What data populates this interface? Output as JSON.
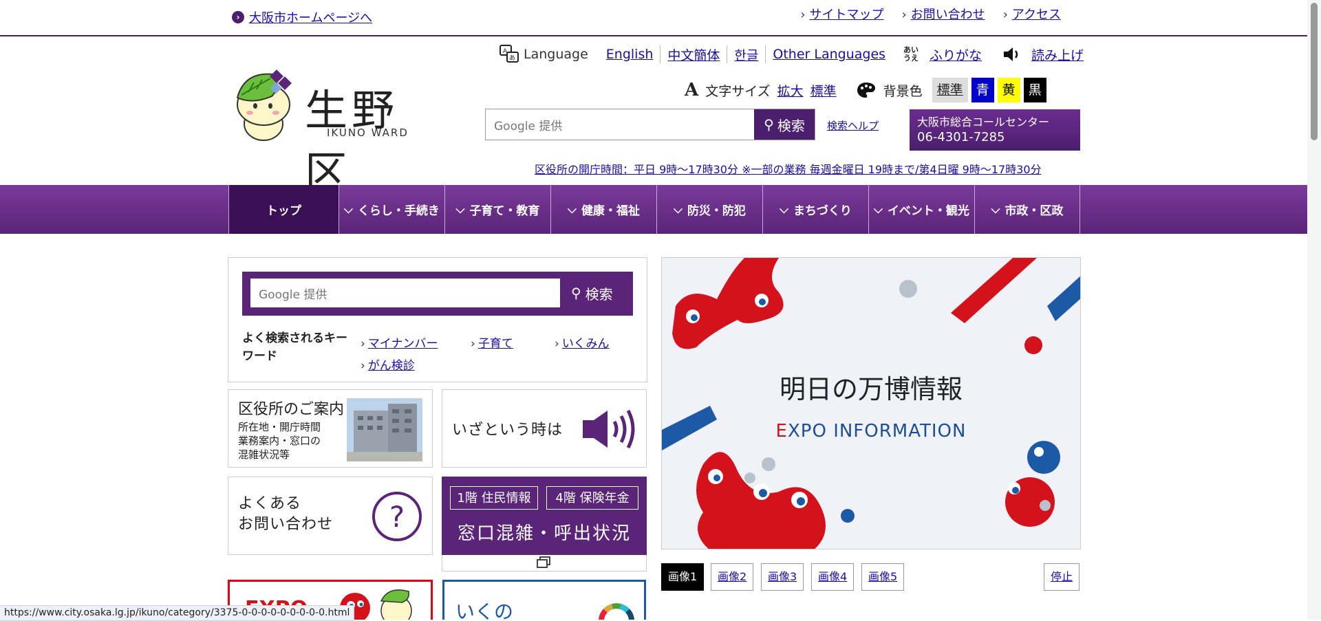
{
  "top": {
    "home_link": "大阪市ホームページへ",
    "links": [
      "サイトマップ",
      "お問い合わせ",
      "アクセス"
    ]
  },
  "header": {
    "logo_text": "生野区",
    "logo_sub": "IKUNO WARD",
    "language_label": "Language",
    "languages": [
      "English",
      "中文簡体",
      "한글",
      "Other Languages"
    ],
    "furigana": "ふりがな",
    "furigana_icon_text": "あいうえ",
    "read_aloud": "読み上げ",
    "font_size_label": "文字サイズ",
    "font_enlarge": "拡大",
    "font_standard": "標準",
    "bg_label": "背景色",
    "bg_options": [
      {
        "label": "標準",
        "bg": "#dddddd",
        "fg": "#222222"
      },
      {
        "label": "青",
        "bg": "#0000cc",
        "fg": "#ffffff"
      },
      {
        "label": "黄",
        "bg": "#ffff00",
        "fg": "#000000"
      },
      {
        "label": "黒",
        "bg": "#000000",
        "fg": "#ffffff"
      }
    ],
    "search_placeholder": "Google 提供",
    "search_button": "検索",
    "search_help": "検索ヘルプ",
    "call_center_name": "大阪市総合コールセンター",
    "call_center_phone": "06-4301-7285",
    "hours": "区役所の開庁時間：平日 9時～17時30分 ※一部の業務 毎週金曜日 19時まで/第4日曜 9時～17時30分"
  },
  "nav": {
    "items": [
      "トップ",
      "くらし・手続き",
      "子育て・教育",
      "健康・福祉",
      "防災・防犯",
      "まちづくり",
      "イベント・観光",
      "市政・区政"
    ]
  },
  "search_card": {
    "placeholder": "Google 提供",
    "button": "検索",
    "keywords_label": "よく検索されるキーワード",
    "keywords": [
      "マイナンバー",
      "子育て",
      "いくみん",
      "がん検診"
    ]
  },
  "tiles": {
    "office_title": "区役所のご案内",
    "office_lines": [
      "所在地・開庁時間",
      "業務案内・窓口の",
      "混雑状況等"
    ],
    "emergency_title": "いざという時は",
    "faq_line1": "よくある",
    "faq_line2": "お問い合わせ",
    "window_floor1": "1階 住民情報",
    "window_floor4": "4階 保険年金",
    "window_title": "窓口混雑・呼出状況"
  },
  "slideshow": {
    "title": "明日の万博情報",
    "subtitle_first": "E",
    "subtitle_rest": "XPO INFORMATION",
    "buttons": [
      "画像1",
      "画像2",
      "画像3",
      "画像4",
      "画像5"
    ],
    "active_index": 0,
    "stop_button": "停止"
  },
  "bottom": {
    "banner1_text": "EXPO",
    "banner2_text": "いくの"
  },
  "status_url": "https://www.city.osaka.lg.jp/ikuno/category/3375-0-0-0-0-0-0-0-0-0.html",
  "colors": {
    "brand": "#4b1e6e",
    "expo_red": "#e50012",
    "expo_blue": "#1d5aa6"
  }
}
